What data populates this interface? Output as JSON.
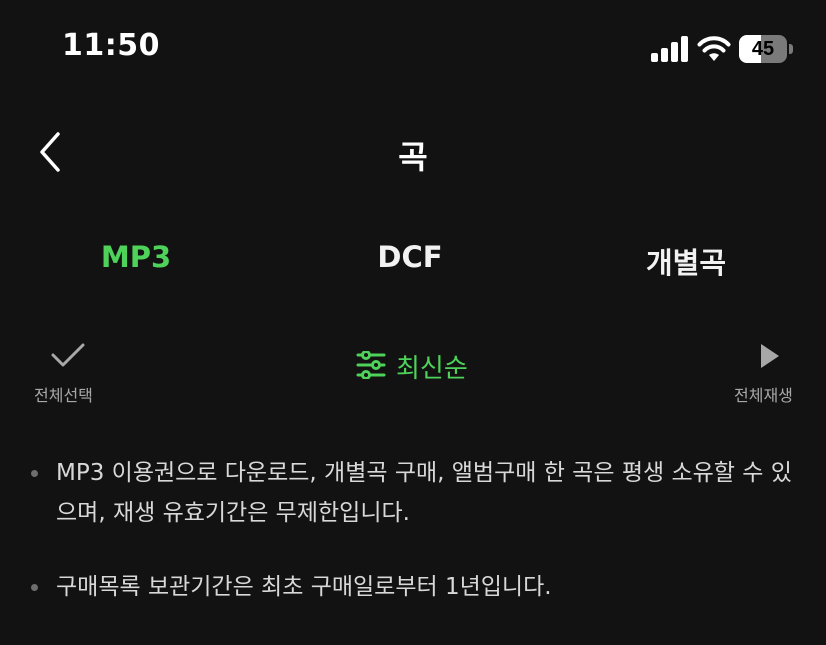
{
  "status_bar": {
    "time": "11:50",
    "battery": "45",
    "battery_level": 0.45,
    "icons": [
      "cellular-signal-icon",
      "wifi-icon",
      "battery-icon"
    ]
  },
  "nav": {
    "back_icon": "chevron-left-icon",
    "title": "곡"
  },
  "tabs": [
    {
      "label": "MP3",
      "active": true
    },
    {
      "label": "DCF",
      "active": false
    },
    {
      "label": "개별곡",
      "active": false
    }
  ],
  "toolbar": {
    "select_all_icon": "checkmark-icon",
    "select_all_label": "전체선택",
    "sort_icon": "sliders-icon",
    "sort_label": "최신순",
    "play_all_icon": "play-icon",
    "play_all_label": "전체재생"
  },
  "notes": [
    "MP3 이용권으로 다운로드, 개별곡 구매, 앨범구매 한 곡은 평생 소유할 수 있으며, 재생 유효기간은 무제한입니다.",
    "구매목록 보관기간은 최초 구매일로부터 1년입니다."
  ],
  "colors": {
    "background": "#121212",
    "accent": "#4ed25a",
    "text": "#ffffff",
    "muted": "#a8a8a8"
  }
}
